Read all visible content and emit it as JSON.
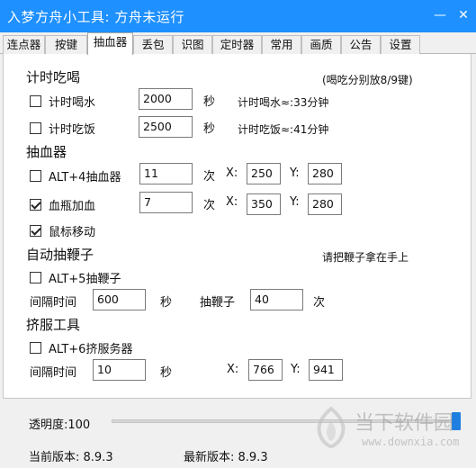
{
  "window": {
    "title": "入梦方舟小工具: 方舟未运行"
  },
  "tabs": [
    "连点器",
    "按键",
    "抽血器",
    "丢包",
    "识图",
    "定时器",
    "常用",
    "画质",
    "公告",
    "设置"
  ],
  "eat_drink": {
    "heading": "计时吃喝",
    "hint": "(喝吃分别放8/9键)",
    "drink": {
      "label": "计时喝水",
      "value": "2000",
      "unit": "秒",
      "info": "计时喝水≈:33分钟",
      "checked": false
    },
    "eat": {
      "label": "计时吃饭",
      "value": "2500",
      "unit": "秒",
      "info": "计时吃饭≈:41分钟",
      "checked": false
    }
  },
  "blood": {
    "heading": "抽血器",
    "alt4": {
      "label": "ALT+4抽血器",
      "count": "11",
      "count_unit": "次",
      "x_label": "X:",
      "x": "250",
      "y_label": "Y:",
      "y": "280",
      "checked": false
    },
    "bottle": {
      "label": "血瓶加血",
      "count": "7",
      "count_unit": "次",
      "x_label": "X:",
      "x": "350",
      "y_label": "Y:",
      "y": "280",
      "checked": true
    },
    "mouse_move": {
      "label": "鼠标移动",
      "checked": true
    }
  },
  "whip": {
    "heading": "自动抽鞭子",
    "hint": "请把鞭子拿在手上",
    "alt5": {
      "label": "ALT+5抽鞭子",
      "checked": false
    },
    "interval_label": "间隔时间",
    "interval": "600",
    "interval_unit": "秒",
    "whip_label": "抽鞭子",
    "whip_count": "40",
    "whip_unit": "次"
  },
  "squeeze": {
    "heading": "挤服工具",
    "alt6": {
      "label": "ALT+6挤服务器",
      "checked": false
    },
    "interval_label": "间隔时间",
    "interval": "10",
    "interval_unit": "秒",
    "x_label": "X:",
    "x": "766",
    "y_label": "Y:",
    "y": "941"
  },
  "footer": {
    "opacity_label": "透明度:100",
    "opacity_value": 100,
    "current_version": "当前版本: 8.9.3",
    "latest_version": "最新版本: 8.9.3"
  },
  "watermark": {
    "text": "当下软件园",
    "url": "www.downxia.com"
  },
  "colors": {
    "titlebar": "#1e90ff",
    "slider_thumb": "#1e7fe0"
  }
}
